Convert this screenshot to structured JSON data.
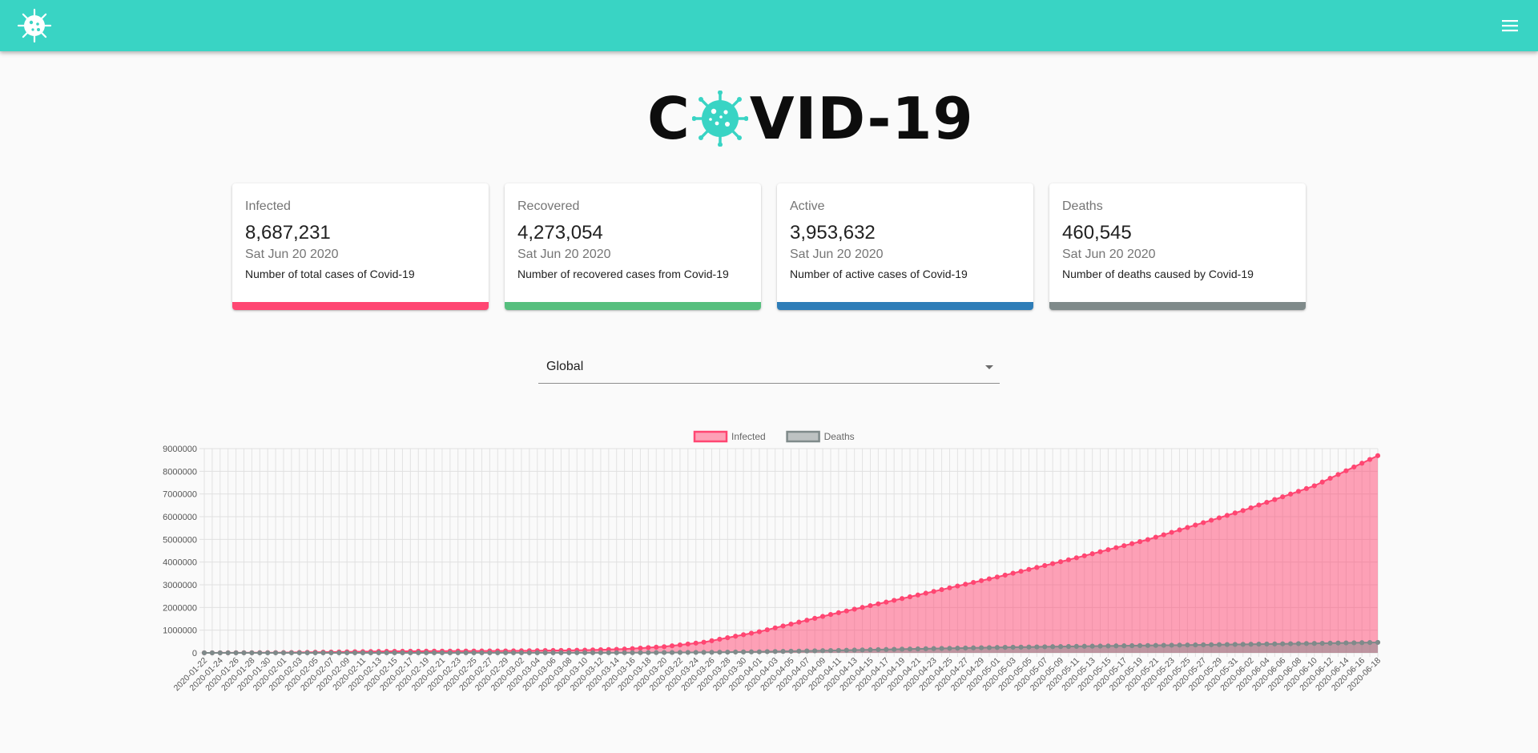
{
  "header": {
    "logo_icon": "virus-icon",
    "menu_icon": "hamburger-menu-icon",
    "color": "#39d4c4"
  },
  "brand": {
    "text_before": "C",
    "text_after": "VID-19"
  },
  "cards": [
    {
      "title": "Infected",
      "value": "8,687,231",
      "date": "Sat Jun 20 2020",
      "description": "Number of total cases of Covid-19",
      "color": "#ff4672"
    },
    {
      "title": "Recovered",
      "value": "4,273,054",
      "date": "Sat Jun 20 2020",
      "description": "Number of recovered cases from Covid-19",
      "color": "#56bf7e"
    },
    {
      "title": "Active",
      "value": "3,953,632",
      "date": "Sat Jun 20 2020",
      "description": "Number of active cases of Covid-19",
      "color": "#2e7db8"
    },
    {
      "title": "Deaths",
      "value": "460,545",
      "date": "Sat Jun 20 2020",
      "description": "Number of deaths caused by Covid-19",
      "color": "#7f8a8a"
    }
  ],
  "country_select": {
    "value": "Global"
  },
  "chart_data": {
    "type": "area",
    "x_start": "2020-01-22",
    "x_end": "2020-06-18",
    "x_tick_labels": [
      "2020-01-22",
      "2020-01-24",
      "2020-01-26",
      "2020-01-28",
      "2020-01-30",
      "2020-02-01",
      "2020-02-03",
      "2020-02-05",
      "2020-02-07",
      "2020-02-09",
      "2020-02-11",
      "2020-02-13",
      "2020-02-15",
      "2020-02-17",
      "2020-02-19",
      "2020-02-21",
      "2020-02-23",
      "2020-02-25",
      "2020-02-27",
      "2020-02-29",
      "2020-03-02",
      "2020-03-04",
      "2020-03-06",
      "2020-03-08",
      "2020-03-10",
      "2020-03-12",
      "2020-03-14",
      "2020-03-16",
      "2020-03-18",
      "2020-03-20",
      "2020-03-22",
      "2020-03-24",
      "2020-03-26",
      "2020-03-28",
      "2020-03-30",
      "2020-04-01",
      "2020-04-03",
      "2020-04-05",
      "2020-04-07",
      "2020-04-09",
      "2020-04-11",
      "2020-04-13",
      "2020-04-15",
      "2020-04-17",
      "2020-04-19",
      "2020-04-21",
      "2020-04-23",
      "2020-04-25",
      "2020-04-27",
      "2020-04-29",
      "2020-05-01",
      "2020-05-03",
      "2020-05-05",
      "2020-05-07",
      "2020-05-09",
      "2020-05-11",
      "2020-05-13",
      "2020-05-15",
      "2020-05-17",
      "2020-05-19",
      "2020-05-21",
      "2020-05-23",
      "2020-05-25",
      "2020-05-27",
      "2020-05-29",
      "2020-05-31",
      "2020-06-02",
      "2020-06-04",
      "2020-06-06",
      "2020-06-08",
      "2020-06-10",
      "2020-06-12",
      "2020-06-14",
      "2020-06-16",
      "2020-06-18"
    ],
    "y_ticks": [
      "0",
      "1000000",
      "2000000",
      "3000000",
      "4000000",
      "5000000",
      "6000000",
      "7000000",
      "8000000",
      "9000000"
    ],
    "ylim": [
      0,
      9000000
    ],
    "grid": true,
    "legend_position": "top",
    "series": [
      {
        "name": "Infected",
        "color": "#ff4672",
        "fill": "rgba(255,70,114,0.5)",
        "keyframes": [
          [
            "2020-01-22",
            555
          ],
          [
            "2020-02-01",
            12000
          ],
          [
            "2020-02-15",
            69000
          ],
          [
            "2020-03-01",
            88000
          ],
          [
            "2020-03-10",
            118000
          ],
          [
            "2020-03-15",
            167000
          ],
          [
            "2020-03-20",
            272000
          ],
          [
            "2020-03-25",
            468000
          ],
          [
            "2020-04-01",
            932000
          ],
          [
            "2020-04-10",
            1690000
          ],
          [
            "2020-04-20",
            2470000
          ],
          [
            "2020-05-01",
            3340000
          ],
          [
            "2020-05-10",
            4100000
          ],
          [
            "2020-05-20",
            4990000
          ],
          [
            "2020-06-01",
            6270000
          ],
          [
            "2020-06-10",
            7360000
          ],
          [
            "2020-06-18",
            8687231
          ]
        ]
      },
      {
        "name": "Deaths",
        "color": "#7f8a8a",
        "fill": "rgba(127,138,138,0.5)",
        "keyframes": [
          [
            "2020-01-22",
            17
          ],
          [
            "2020-02-15",
            1500
          ],
          [
            "2020-03-01",
            3000
          ],
          [
            "2020-03-15",
            6500
          ],
          [
            "2020-03-25",
            21000
          ],
          [
            "2020-04-01",
            47000
          ],
          [
            "2020-04-10",
            102000
          ],
          [
            "2020-04-20",
            170000
          ],
          [
            "2020-05-01",
            238000
          ],
          [
            "2020-05-10",
            282000
          ],
          [
            "2020-05-20",
            325000
          ],
          [
            "2020-06-01",
            375000
          ],
          [
            "2020-06-10",
            416000
          ],
          [
            "2020-06-18",
            460545
          ]
        ]
      }
    ]
  }
}
